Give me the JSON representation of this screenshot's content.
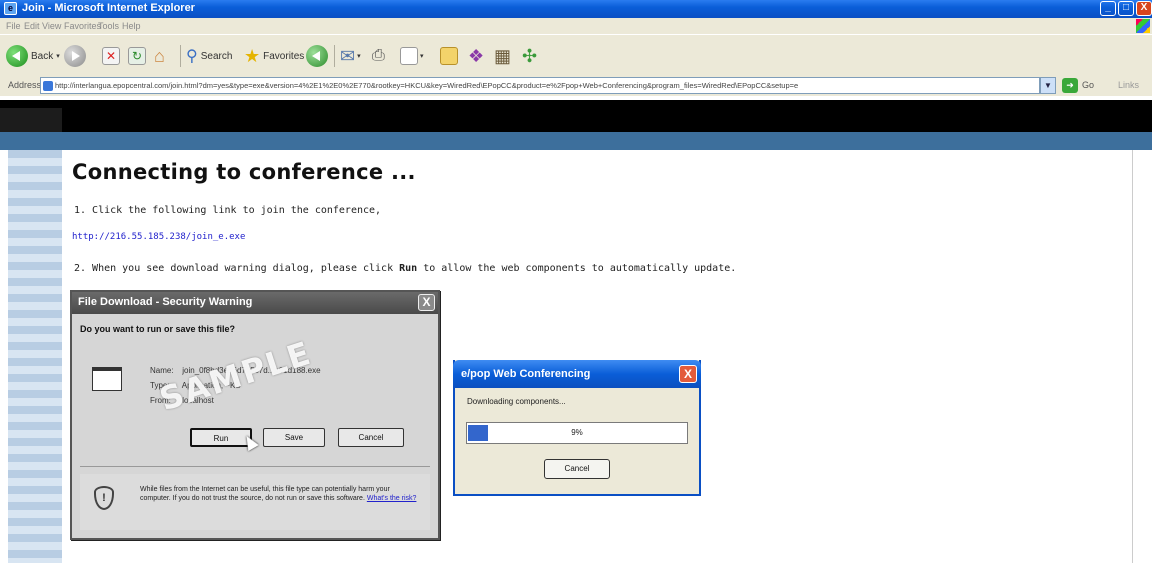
{
  "window": {
    "title": "Join - Microsoft Internet Explorer",
    "buttons": {
      "minimize": "_",
      "maximize": "□",
      "close": "X"
    }
  },
  "menu": [
    "File",
    "Edit",
    "View",
    "Favorites",
    "Tools",
    "Help"
  ],
  "toolbar": {
    "back_label": "Back",
    "search_label": "Search",
    "favorites_label": "Favorites"
  },
  "address": {
    "label": "Address",
    "url": "http://interlangua.epopcentral.com/join.html?dm=yes&type=exe&version=4%2E1%2E0%2E770&rootkey=HKCU&key=WiredRed\\EPopCC&product=e%2Fpop+Web+Conferencing&program_files=WiredRed\\EPopCC&setup=e",
    "go_label": "Go",
    "links_label": "Links"
  },
  "page": {
    "title": "Connecting to conference ...",
    "step1": "1.  Click the following link to join the conference,",
    "join_link": "http://216.55.185.238/join_e.exe",
    "step2_before": "2.  When you see download warning dialog, please click ",
    "step2_bold": "Run",
    "step2_after": " to allow the web components to automatically update."
  },
  "download_dialog": {
    "title": "File Download - Security Warning",
    "close_glyph": "X",
    "question": "Do you want to run or save this file?",
    "name_label": "Name:",
    "name_value": "join_0f8bd3e96d7a5c7d...e01d188.exe",
    "type_label": "Type:",
    "type_value": "Application, ~KB",
    "from_label": "From:",
    "from_value": "localhost",
    "run_label": "Run",
    "save_label": "Save",
    "cancel_label": "Cancel",
    "warning_text": "While files from the Internet can be useful, this file type can potentially harm your computer. If you do not trust the source, do not run or save this software. ",
    "warning_link": "What's the risk?",
    "watermark": "SAMPLE"
  },
  "conf_dialog": {
    "title": "e/pop Web Conferencing",
    "close_glyph": "X",
    "status": "Downloading components...",
    "progress_text": "9%",
    "progress_fraction": 0.09,
    "cancel_label": "Cancel"
  },
  "colors": {
    "xp_blue": "#0a5ed8",
    "page_band_blue": "#3d6f9c",
    "link_blue": "#2222cc",
    "progress_blue": "#3366cc"
  }
}
